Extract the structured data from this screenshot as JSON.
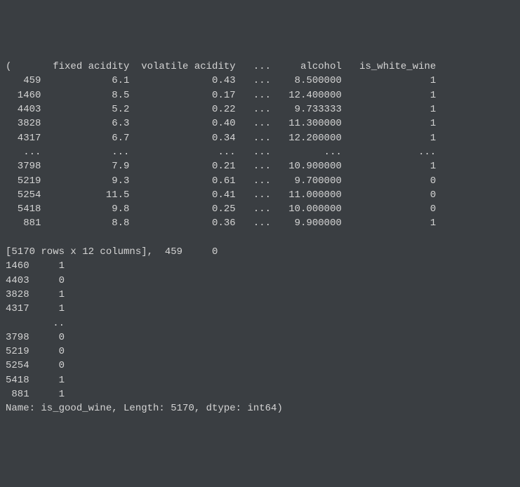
{
  "dataframe": {
    "columns": [
      "fixed acidity",
      "volatile acidity",
      "...",
      "alcohol",
      "is_white_wine"
    ],
    "head_rows": [
      {
        "idx": "459",
        "fixed_acidity": "6.1",
        "volatile_acidity": "0.43",
        "ellipsis": "...",
        "alcohol": "8.500000",
        "is_white_wine": "1"
      },
      {
        "idx": "1460",
        "fixed_acidity": "8.5",
        "volatile_acidity": "0.17",
        "ellipsis": "...",
        "alcohol": "12.400000",
        "is_white_wine": "1"
      },
      {
        "idx": "4403",
        "fixed_acidity": "5.2",
        "volatile_acidity": "0.22",
        "ellipsis": "...",
        "alcohol": "9.733333",
        "is_white_wine": "1"
      },
      {
        "idx": "3828",
        "fixed_acidity": "6.3",
        "volatile_acidity": "0.40",
        "ellipsis": "...",
        "alcohol": "11.300000",
        "is_white_wine": "1"
      },
      {
        "idx": "4317",
        "fixed_acidity": "6.7",
        "volatile_acidity": "0.34",
        "ellipsis": "...",
        "alcohol": "12.200000",
        "is_white_wine": "1"
      }
    ],
    "truncation_row": {
      "idx": "...",
      "fixed_acidity": "...",
      "volatile_acidity": "...",
      "ellipsis": "...",
      "alcohol": "...",
      "is_white_wine": "..."
    },
    "tail_rows": [
      {
        "idx": "3798",
        "fixed_acidity": "7.9",
        "volatile_acidity": "0.21",
        "ellipsis": "...",
        "alcohol": "10.900000",
        "is_white_wine": "1"
      },
      {
        "idx": "5219",
        "fixed_acidity": "9.3",
        "volatile_acidity": "0.61",
        "ellipsis": "...",
        "alcohol": "9.700000",
        "is_white_wine": "0"
      },
      {
        "idx": "5254",
        "fixed_acidity": "11.5",
        "volatile_acidity": "0.41",
        "ellipsis": "...",
        "alcohol": "11.000000",
        "is_white_wine": "0"
      },
      {
        "idx": "5418",
        "fixed_acidity": "9.8",
        "volatile_acidity": "0.25",
        "ellipsis": "...",
        "alcohol": "10.000000",
        "is_white_wine": "0"
      },
      {
        "idx": "881",
        "fixed_acidity": "8.8",
        "volatile_acidity": "0.36",
        "ellipsis": "...",
        "alcohol": "9.900000",
        "is_white_wine": "1"
      }
    ],
    "shape_info": "[5170 rows x 12 columns]"
  },
  "series": {
    "first_idx": "459",
    "first_val": "0",
    "head_rows": [
      {
        "idx": "1460",
        "val": "1"
      },
      {
        "idx": "4403",
        "val": "0"
      },
      {
        "idx": "3828",
        "val": "1"
      },
      {
        "idx": "4317",
        "val": "1"
      }
    ],
    "truncation": "..",
    "tail_rows": [
      {
        "idx": "3798",
        "val": "0"
      },
      {
        "idx": "5219",
        "val": "0"
      },
      {
        "idx": "5254",
        "val": "0"
      },
      {
        "idx": "5418",
        "val": "1"
      },
      {
        "idx": "881",
        "val": "1"
      }
    ],
    "footer": "Name: is_good_wine, Length: 5170, dtype: int64)"
  },
  "layout": {
    "widths": {
      "idx": 5,
      "fa": 14,
      "va": 17,
      "ell": 5,
      "alc": 11,
      "iww": 15
    },
    "series_widths": {
      "idx": 4,
      "val": 6
    },
    "tuple_open": "(",
    "tuple_sep": ", "
  }
}
